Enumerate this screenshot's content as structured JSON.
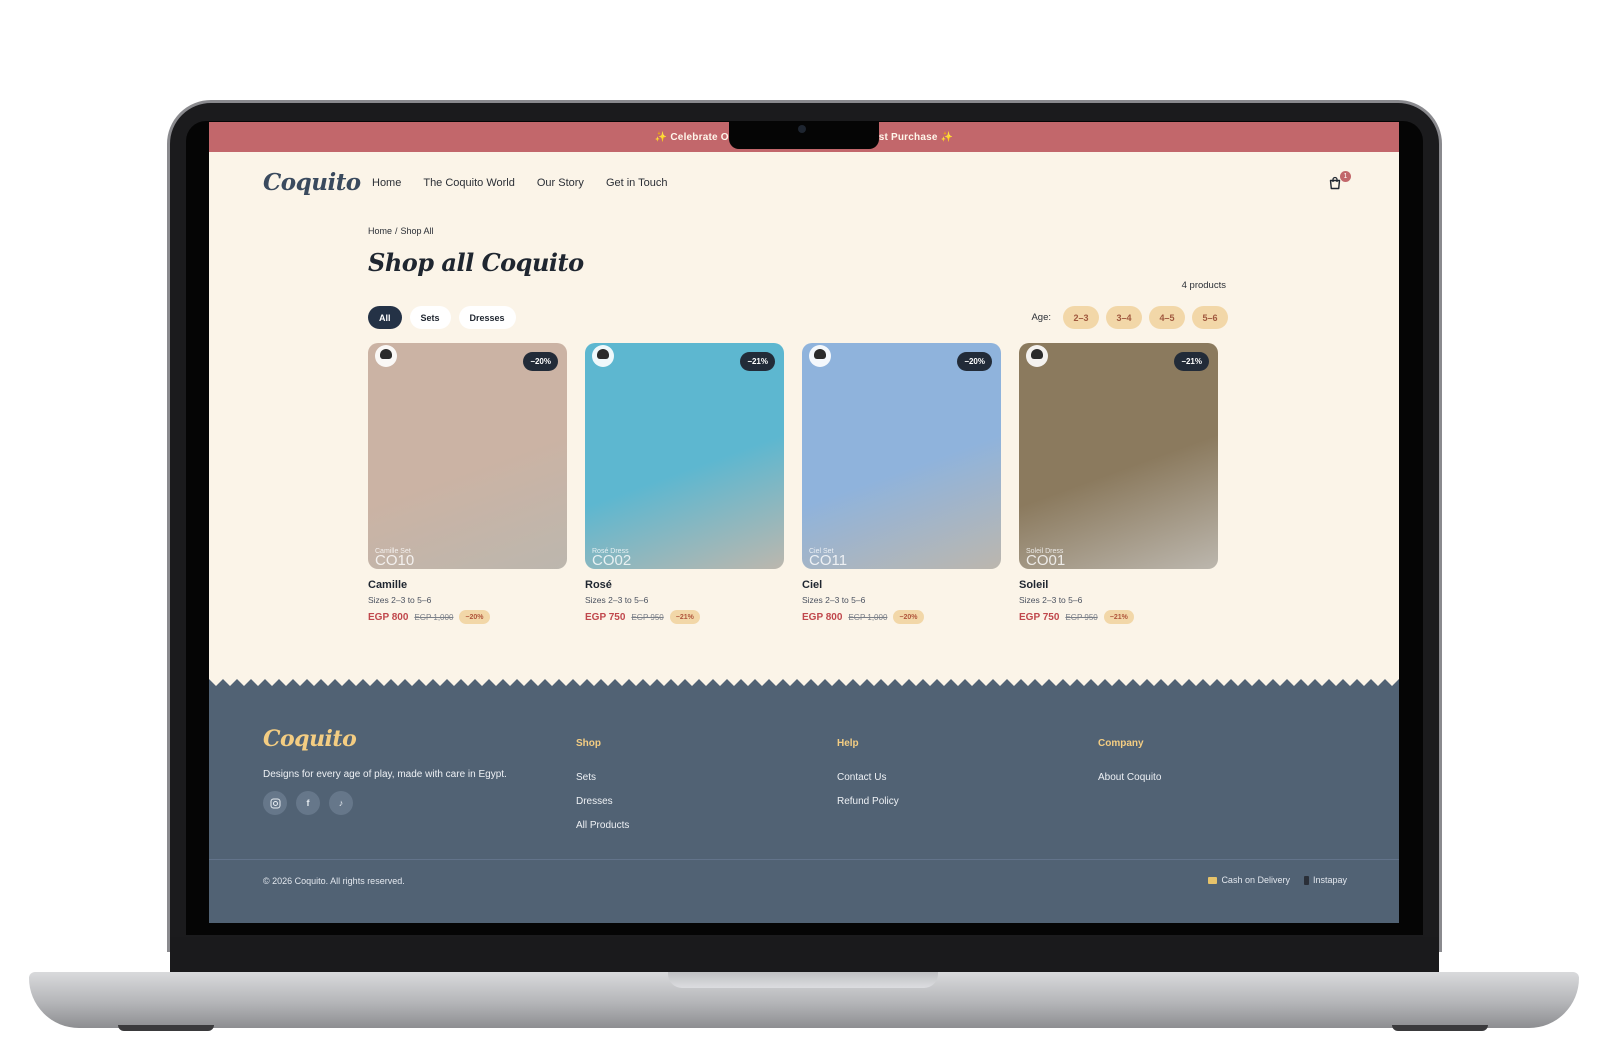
{
  "announcement": {
    "left": "✨ Celebrate O",
    "right": "st Purchase ✨"
  },
  "brand": {
    "logo": "Coquito"
  },
  "nav": {
    "items": [
      "Home",
      "The Coquito World",
      "Our Story",
      "Get in Touch"
    ],
    "cart_count": "1"
  },
  "breadcrumb": {
    "home": "Home",
    "separator": "/",
    "current": "Shop All"
  },
  "page": {
    "title": "Shop all Coquito",
    "product_count": "4 products"
  },
  "filters": {
    "categories": [
      "All",
      "Sets",
      "Dresses"
    ],
    "active": "All",
    "age_label": "Age:",
    "ages": [
      "2–3",
      "3–4",
      "4–5",
      "5–6"
    ]
  },
  "products": [
    {
      "name": "Camille",
      "sizes": "Sizes 2–3 to 5–6",
      "price": "EGP 800",
      "old_price": "EGP 1,000",
      "discount": "−20%",
      "photo_small": "Camille Set",
      "photo_big": "CO10",
      "bg": "#cbb3a4"
    },
    {
      "name": "Rosé",
      "sizes": "Sizes 2–3 to 5–6",
      "price": "EGP 750",
      "old_price": "EGP 950",
      "discount": "−21%",
      "photo_small": "Rosé Dress",
      "photo_big": "CO02",
      "bg": "#5db7d0"
    },
    {
      "name": "Ciel",
      "sizes": "Sizes 2–3 to 5–6",
      "price": "EGP 800",
      "old_price": "EGP 1,000",
      "discount": "−20%",
      "photo_small": "Ciel Set",
      "photo_big": "CO11",
      "bg": "#8fb3dc"
    },
    {
      "name": "Soleil",
      "sizes": "Sizes 2–3 to 5–6",
      "price": "EGP 750",
      "old_price": "EGP 950",
      "discount": "−21%",
      "photo_small": "Soleil Dress",
      "photo_big": "CO01",
      "bg": "#8b7a5e"
    }
  ],
  "footer": {
    "logo": "Coquito",
    "tagline": "Designs for every age of play, made with care in Egypt.",
    "shop": {
      "heading": "Shop",
      "links": [
        "Sets",
        "Dresses",
        "All Products"
      ]
    },
    "help": {
      "heading": "Help",
      "links": [
        "Contact Us",
        "Refund Policy"
      ]
    },
    "company": {
      "heading": "Company",
      "links": [
        "About Coquito"
      ]
    },
    "copyright": "© 2026 Coquito. All rights reserved.",
    "payments": [
      "Cash on Delivery",
      "Instapay"
    ]
  },
  "colors": {
    "announcement": "#c2676b",
    "page_bg": "#fbf4e8",
    "footer_bg": "#516274",
    "accent_gold": "#f4cd82",
    "sale_red": "#c0474c"
  }
}
